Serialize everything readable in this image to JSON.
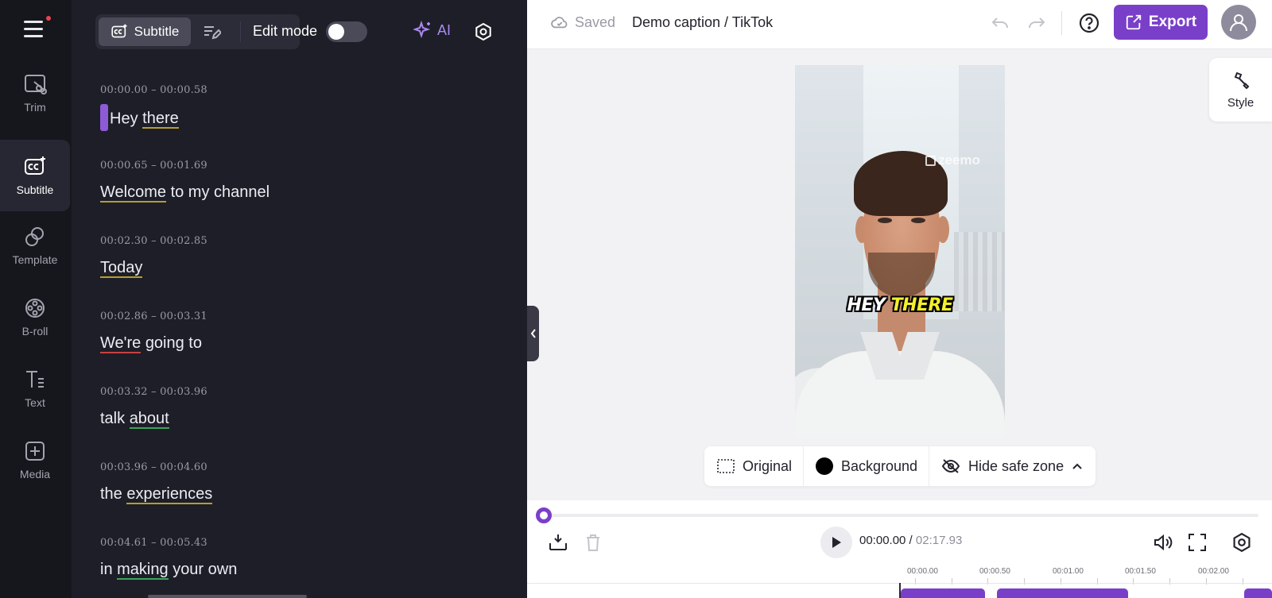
{
  "app": {
    "saved_status": "Saved",
    "document_title": "Demo caption / TikTok",
    "export_label": "Export",
    "accent_color": "#7a3fc9"
  },
  "rail": {
    "items": [
      {
        "label": "Trim",
        "icon": "trim-icon"
      },
      {
        "label": "Subtitle",
        "icon": "cc-icon",
        "active": true
      },
      {
        "label": "Template",
        "icon": "template-icon"
      },
      {
        "label": "B-roll",
        "icon": "film-reel-icon"
      },
      {
        "label": "Text",
        "icon": "text-icon"
      },
      {
        "label": "Media",
        "icon": "add-media-icon"
      }
    ]
  },
  "panel": {
    "subtitle_tab": "Subtitle",
    "edit_mode_label": "Edit mode",
    "edit_mode_on": false,
    "ai_label": "AI",
    "cues": [
      {
        "time": "00:00.00 – 00:00.58",
        "words": [
          {
            "t": "Hey",
            "u": ""
          },
          {
            "t": "there",
            "u": "y"
          }
        ]
      },
      {
        "time": "00:00.65 – 00:01.69",
        "words": [
          {
            "t": "Welcome",
            "u": "y"
          },
          {
            "t": "to my channel",
            "u": ""
          }
        ]
      },
      {
        "time": "00:02.30 – 00:02.85",
        "words": [
          {
            "t": "Today",
            "u": "y"
          }
        ]
      },
      {
        "time": "00:02.86 – 00:03.31",
        "words": [
          {
            "t": "We're",
            "u": "r"
          },
          {
            "t": "going to",
            "u": ""
          }
        ]
      },
      {
        "time": "00:03.32 – 00:03.96",
        "words": [
          {
            "t": "talk",
            "u": ""
          },
          {
            "t": "about",
            "u": "g"
          }
        ]
      },
      {
        "time": "00:03.96 – 00:04.60",
        "words": [
          {
            "t": "the",
            "u": ""
          },
          {
            "t": "experiences",
            "u": "y"
          }
        ]
      },
      {
        "time": "00:04.61 – 00:05.43",
        "words": [
          {
            "t": "in",
            "u": ""
          },
          {
            "t": "making",
            "u": "g"
          },
          {
            "t": "your own",
            "u": ""
          }
        ]
      }
    ]
  },
  "style_tab": {
    "label": "Style"
  },
  "preview": {
    "watermark": "zeemo",
    "caption_word_1": "HEY",
    "caption_word_2": "THERE",
    "caption_highlight_color": "#f4ef2a"
  },
  "preview_controls": {
    "original_label": "Original",
    "background_label": "Background",
    "safe_zone_label": "Hide safe zone"
  },
  "timeline": {
    "current_time": "00:00.00",
    "total_time": "02:17.93",
    "progress": 0,
    "ruler_ticks": [
      "00:00.00",
      "00:00.50",
      "00:01.00",
      "00:01.50",
      "00:02.00"
    ]
  }
}
